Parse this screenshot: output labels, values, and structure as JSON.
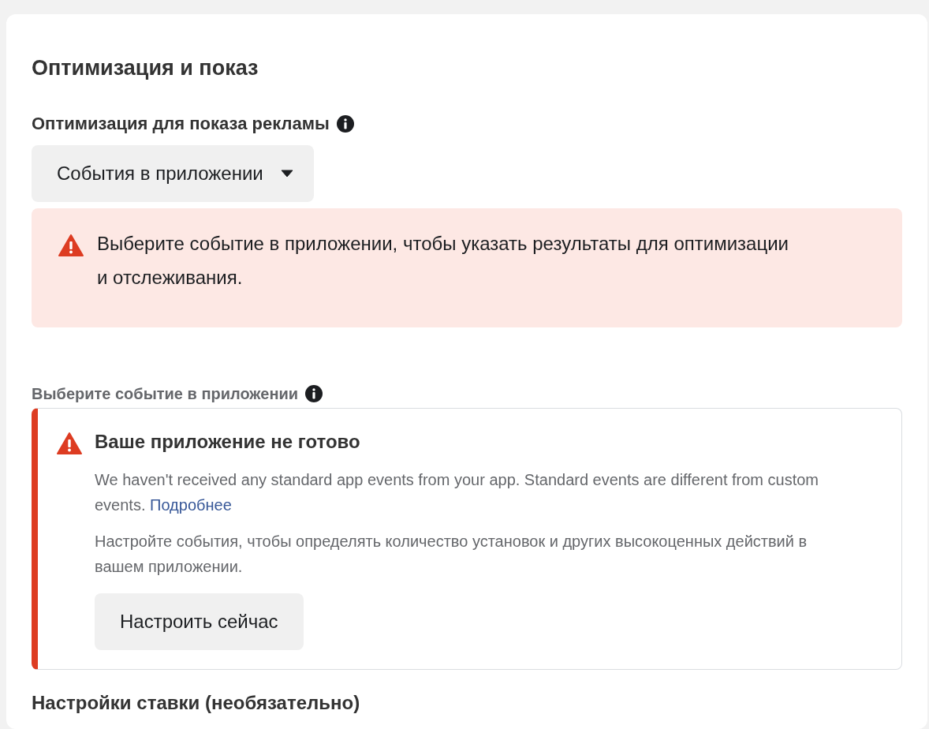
{
  "section": {
    "title": "Оптимизация и показ"
  },
  "optimization": {
    "label": "Оптимизация для показа рекламы",
    "dropdown": {
      "value": "События в приложении"
    }
  },
  "alert": {
    "kind": "error",
    "text": "Выберите событие в приложении, чтобы указать результаты для оптимизации и отслеживания."
  },
  "app_event": {
    "label": "Выберите событие в приложении",
    "notice": {
      "kind": "error",
      "title": "Ваше приложение не готово",
      "paragraphs": [
        {
          "text": "We haven't received any standard app events from your app. Standard events are different from custom events.",
          "link": "Подробнее"
        },
        {
          "text": "Настройте события, чтобы определять количество установок и других высокоценных действий в вашем приложении."
        }
      ],
      "button": "Настроить сейчас"
    }
  },
  "bid_settings": {
    "title": "Настройки ставки (необязательно)"
  }
}
